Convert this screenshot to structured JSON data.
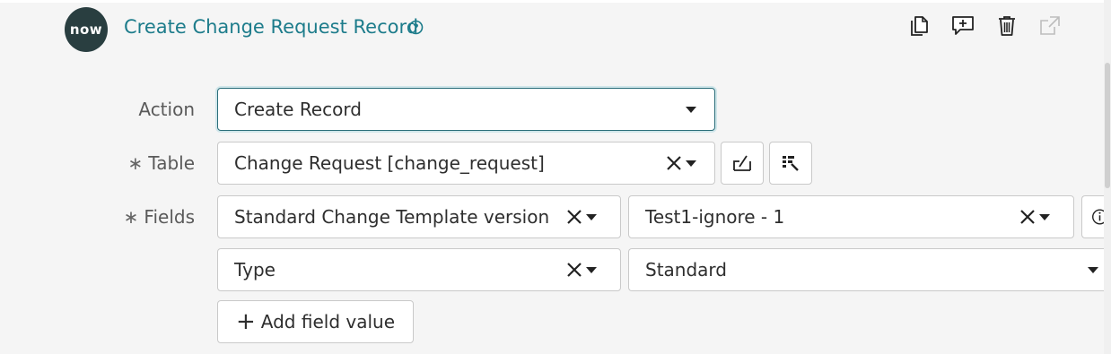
{
  "header": {
    "logo_text": "now",
    "title": "Create Change Request Record"
  },
  "toolbar": {
    "icons": [
      "copy-icon",
      "add-comment-icon",
      "trash-icon",
      "open-external-icon"
    ]
  },
  "form": {
    "action": {
      "label": "Action",
      "value": "Create Record"
    },
    "table": {
      "label": "Table",
      "required_mark": "∗",
      "value": "Change Request [change_request]"
    },
    "fields": {
      "label": "Fields",
      "required_mark": "∗",
      "rows": [
        {
          "field": "Standard Change Template version",
          "value": "Test1-ignore - 1"
        },
        {
          "field": "Type",
          "value": "Standard"
        }
      ]
    },
    "add_field_label": "Add field value"
  },
  "colors": {
    "accent": "#1d7c8b",
    "logo_bg": "#293e40",
    "focus_border": "#2a6d79"
  }
}
